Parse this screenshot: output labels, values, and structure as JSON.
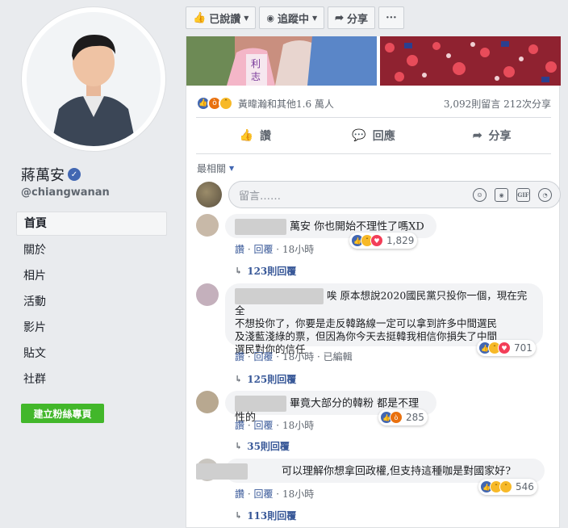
{
  "page": {
    "name": "蔣萬安",
    "handle": "@chiangwanan",
    "nav": [
      "首頁",
      "關於",
      "相片",
      "活動",
      "影片",
      "貼文",
      "社群"
    ],
    "fan_button": "建立粉絲專頁"
  },
  "toolbar": {
    "liked": "已說讚",
    "following": "追蹤中",
    "share": "分享",
    "more": "···"
  },
  "post": {
    "reactions_text": "黃暐瀚和其他1.6 萬人",
    "comments_shares": "3,092則留言  212次分享",
    "actions": {
      "like": "讚",
      "comment": "回應",
      "share": "分享"
    },
    "sort_label": "最相關",
    "composer_placeholder": "留言……"
  },
  "comments": [
    {
      "text": "萬安 你也開始不理性了嗎XD",
      "reaction_count": "1,829",
      "meta": {
        "like": "讚",
        "reply": "回覆",
        "time": "18小時"
      },
      "replies": "123則回覆"
    },
    {
      "text_lines": [
        "唉 原本想說2020國民黨只投你一個，現在完全",
        "不想投你了，你要是走反韓路線一定可以拿到許多中間選民",
        "及淺藍淺綠的票，但因為你今天去挺韓我相信你損失了中間",
        "選民對你的信任"
      ],
      "reaction_count": "701",
      "meta": {
        "like": "讚",
        "reply": "回覆",
        "time": "18小時",
        "edited": "已編輯"
      },
      "replies": "125則回覆"
    },
    {
      "text": "畢竟大部分的韓粉 都是不理性的",
      "reaction_count": "285",
      "meta": {
        "like": "讚",
        "reply": "回覆",
        "time": "18小時"
      },
      "replies": "35則回覆"
    },
    {
      "text": "可以理解你想拿回政權,但支持這種咖是對國家好?",
      "reaction_count": "546",
      "meta": {
        "like": "讚",
        "reply": "回覆",
        "time": "18小時"
      },
      "replies": "113則回覆"
    }
  ],
  "colors": {
    "fb_blue": "#4267b2",
    "link": "#385898",
    "green": "#42b72a"
  }
}
